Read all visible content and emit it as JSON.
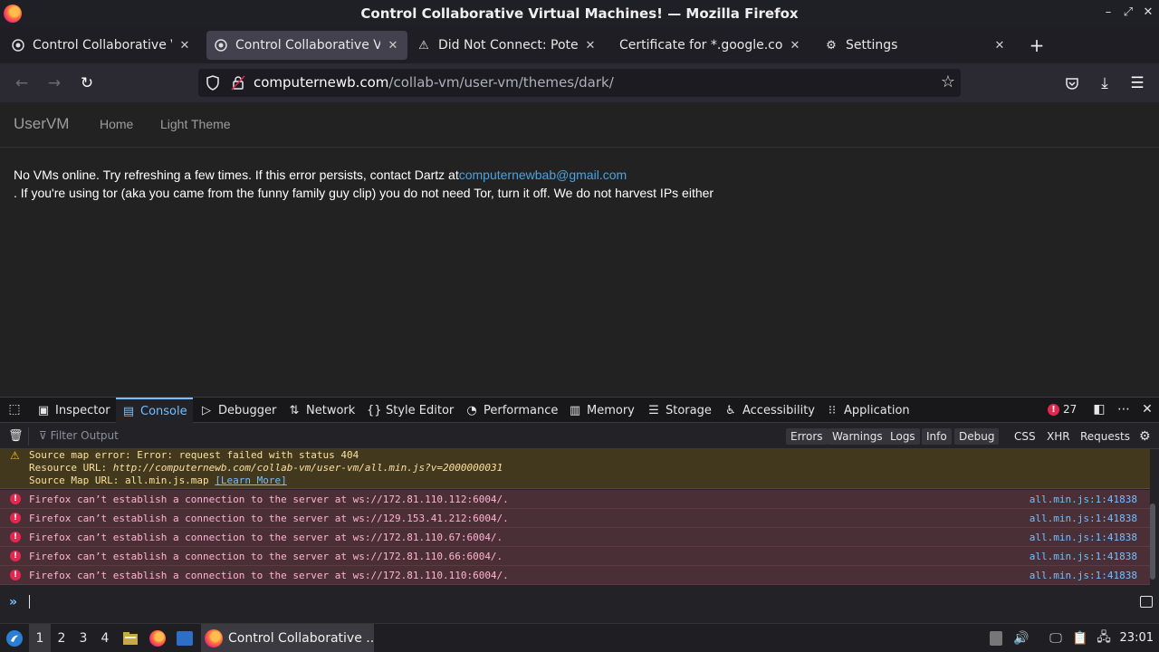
{
  "window": {
    "title": "Control Collaborative Virtual Machines! — Mozilla Firefox"
  },
  "tabs": [
    {
      "label": "Control Collaborative Virtual Machines!",
      "icon": "vm-favicon-icon",
      "active": false
    },
    {
      "label": "Control Collaborative Virtual Machines!",
      "icon": "vm-favicon-icon",
      "active": true
    },
    {
      "label": "Did Not Connect: Potential Security Issue",
      "icon": "warning-icon",
      "active": false
    },
    {
      "label": "Certificate for *.google.com",
      "icon": "",
      "active": false
    },
    {
      "label": "Settings",
      "icon": "gear-icon",
      "active": false
    }
  ],
  "navbar": {
    "url_host": "computernewb.com",
    "url_path": "/collab-vm/user-vm/themes/dark/"
  },
  "page": {
    "brand": "UserVM",
    "nav_links": [
      "Home",
      "Light Theme"
    ],
    "message_line1_prefix": "No VMs online. Try refreshing a few times. If this error persists, contact Dartz at",
    "message_email": "computernewbab@gmail.com",
    "message_line2": ". If you're using tor (aka you came from the funny family guy clip) you do not need Tor, turn it off. We do not harvest IPs either"
  },
  "devtools": {
    "tabs": [
      {
        "label": "Inspector",
        "icon": "inspector-icon"
      },
      {
        "label": "Console",
        "icon": "console-icon",
        "active": true
      },
      {
        "label": "Debugger",
        "icon": "debugger-icon"
      },
      {
        "label": "Network",
        "icon": "network-icon"
      },
      {
        "label": "Style Editor",
        "icon": "style-editor-icon"
      },
      {
        "label": "Performance",
        "icon": "performance-icon"
      },
      {
        "label": "Memory",
        "icon": "memory-icon"
      },
      {
        "label": "Storage",
        "icon": "storage-icon"
      },
      {
        "label": "Accessibility",
        "icon": "accessibility-icon"
      },
      {
        "label": "Application",
        "icon": "application-icon"
      }
    ],
    "error_count": "27",
    "filter_placeholder": "Filter Output",
    "levels": [
      "Errors",
      "Warnings",
      "Logs",
      "Info",
      "Debug"
    ],
    "request_types": [
      "CSS",
      "XHR",
      "Requests"
    ],
    "warning": {
      "line1": "Source map error: Error: request failed with status 404",
      "line2_label": "Resource URL: ",
      "line2_url": "http://computernewb.com/collab-vm/user-vm/all.min.js?v=2000000031",
      "line3_label": "Source Map URL: all.min.js.map ",
      "learn_more": "[Learn More]"
    },
    "errors": [
      {
        "text": "Firefox can’t establish a connection to the server at ws://172.81.110.112:6004/.",
        "source": "all.min.js:1:41838"
      },
      {
        "text": "Firefox can’t establish a connection to the server at ws://129.153.41.212:6004/.",
        "source": "all.min.js:1:41838"
      },
      {
        "text": "Firefox can’t establish a connection to the server at ws://172.81.110.67:6004/.",
        "source": "all.min.js:1:41838"
      },
      {
        "text": "Firefox can’t establish a connection to the server at ws://172.81.110.66:6004/.",
        "source": "all.min.js:1:41838"
      },
      {
        "text": "Firefox can’t establish a connection to the server at ws://172.81.110.110:6004/.",
        "source": "all.min.js:1:41838"
      }
    ]
  },
  "taskbar": {
    "workspaces": [
      "1",
      "2",
      "3",
      "4"
    ],
    "window_label": "Control Collaborative ...",
    "clock": "23:01"
  }
}
